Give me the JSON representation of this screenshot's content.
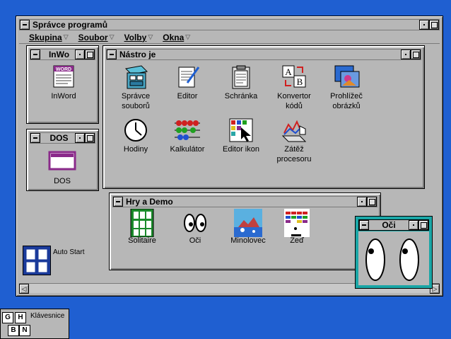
{
  "program_manager": {
    "title": "Správce programů",
    "menus": [
      {
        "label": "Skupina"
      },
      {
        "label": "Soubor"
      },
      {
        "label": "Volby"
      },
      {
        "label": "Okna"
      }
    ]
  },
  "groups": {
    "inwo": {
      "title": "InWo",
      "items": [
        {
          "label": "InWord",
          "icon": "inword-icon"
        }
      ]
    },
    "dos": {
      "title": "DOS",
      "items": [
        {
          "label": "DOS",
          "icon": "dos-icon"
        }
      ]
    },
    "nastroje": {
      "title": "Nástro je",
      "items": [
        {
          "label": "Správce\nsouborů",
          "icon": "file-manager-icon"
        },
        {
          "label": "Editor",
          "icon": "editor-icon"
        },
        {
          "label": "Schránka",
          "icon": "clipboard-icon"
        },
        {
          "label": "Konvertor\nkódů",
          "icon": "code-converter-icon"
        },
        {
          "label": "Prohlížeč\nobrázků",
          "icon": "image-viewer-icon"
        },
        {
          "label": "Hodiny",
          "icon": "clock-icon"
        },
        {
          "label": "Kalkulátor",
          "icon": "calculator-icon"
        },
        {
          "label": "Editor ikon",
          "icon": "icon-editor-icon"
        },
        {
          "label": "Zátěž\nprocesoru",
          "icon": "cpu-load-icon"
        }
      ]
    },
    "hry": {
      "title": "Hry a Demo",
      "items": [
        {
          "label": "Solitaire",
          "icon": "solitaire-icon"
        },
        {
          "label": "Oči",
          "icon": "eyes-icon"
        },
        {
          "label": "Minolovec",
          "icon": "minesweeper-icon"
        },
        {
          "label": "Zeď",
          "icon": "wall-icon"
        }
      ]
    },
    "autostart": {
      "label": "Auto Start"
    }
  },
  "oci_window": {
    "title": "Oči"
  },
  "taskbar": {
    "klavesnice_label": "Klávesnice",
    "keys": [
      "G",
      "H",
      "B",
      "N"
    ]
  },
  "colors": {
    "desktop": "#1f5fd1",
    "window": "#b7b7b7",
    "oci_frame": "#1aa6a6"
  }
}
